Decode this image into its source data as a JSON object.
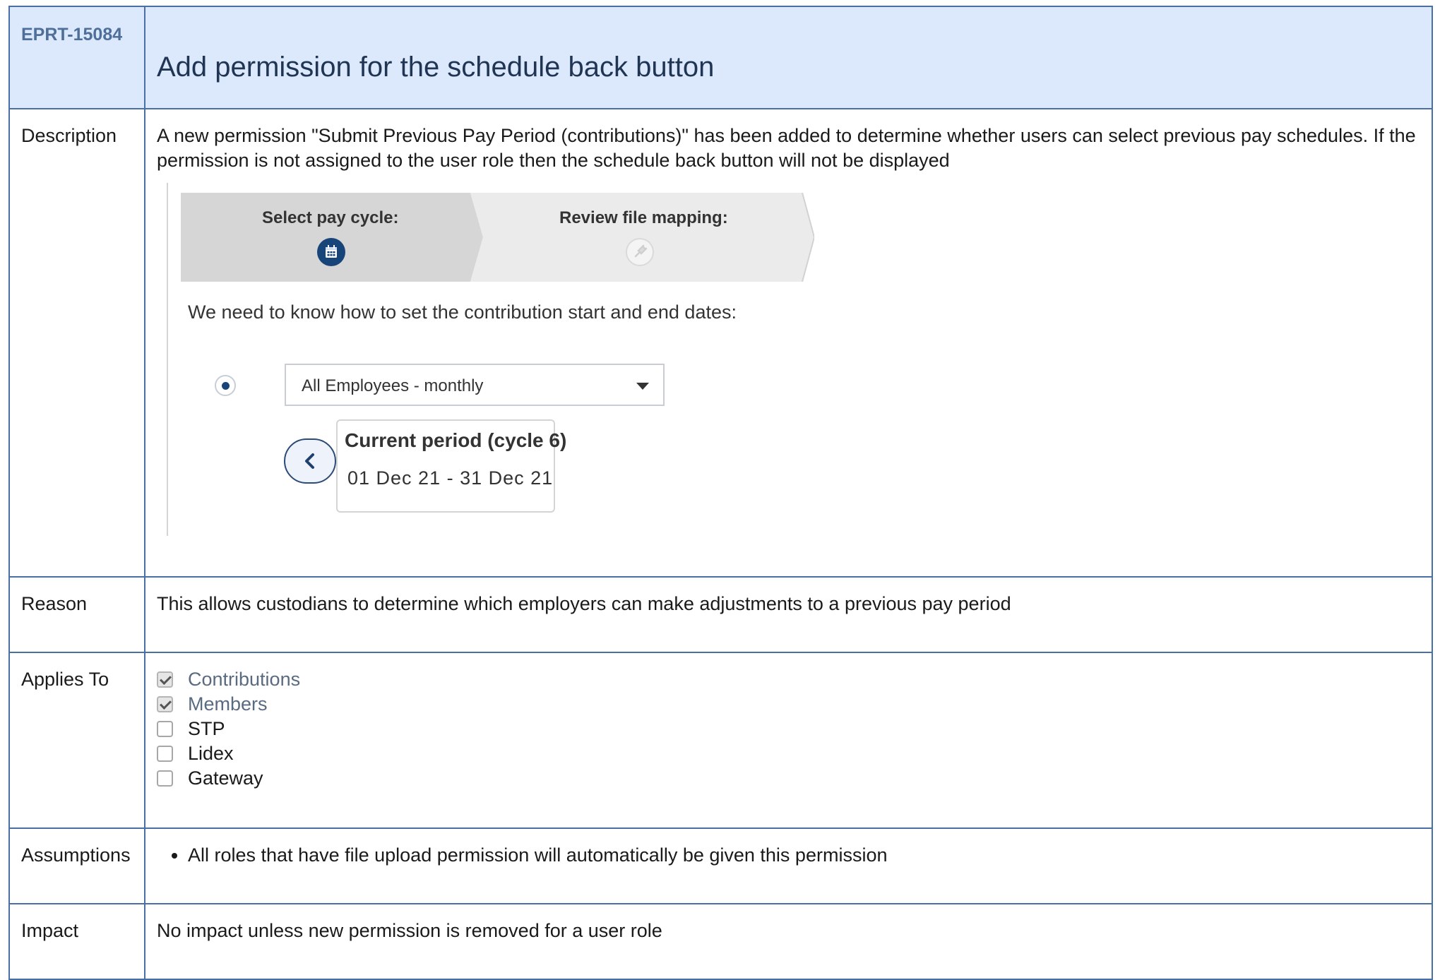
{
  "ticket_id": "EPRT-15084",
  "title": "Add permission for the schedule back button",
  "rows": {
    "description": {
      "label": "Description",
      "text": "A new permission \"Submit Previous Pay Period (contributions)\" has been added to determine whether users can select previous pay schedules. If the permission is not assigned to the user role then the schedule back button will not be displayed",
      "screenshot": {
        "steps": [
          {
            "label": "Select pay cycle:",
            "icon": "calendar-icon",
            "active": true
          },
          {
            "label": "Review file mapping:",
            "icon": "plug-icon",
            "active": false
          }
        ],
        "question": "We need to know how to set the contribution start and end dates:",
        "select_value": "All Employees - monthly",
        "period_title": "Current period (cycle 6)",
        "period_dates": "01 Dec 21 - 31 Dec 21"
      }
    },
    "reason": {
      "label": "Reason",
      "text": "This allows custodians to determine which employers can make adjustments to a previous pay period"
    },
    "applies_to": {
      "label": "Applies To",
      "options": [
        {
          "label": "Contributions",
          "checked": true
        },
        {
          "label": "Members",
          "checked": true
        },
        {
          "label": "STP",
          "checked": false
        },
        {
          "label": "Lidex",
          "checked": false
        },
        {
          "label": "Gateway",
          "checked": false
        }
      ]
    },
    "assumptions": {
      "label": "Assumptions",
      "items": [
        "All roles that have file upload permission will automatically be given this permission"
      ]
    },
    "impact": {
      "label": "Impact",
      "text": "No impact unless new permission is removed for a user role"
    }
  },
  "colors": {
    "header_bg": "#dce8fb",
    "border": "#4a6fa5",
    "accent": "#17457a"
  }
}
